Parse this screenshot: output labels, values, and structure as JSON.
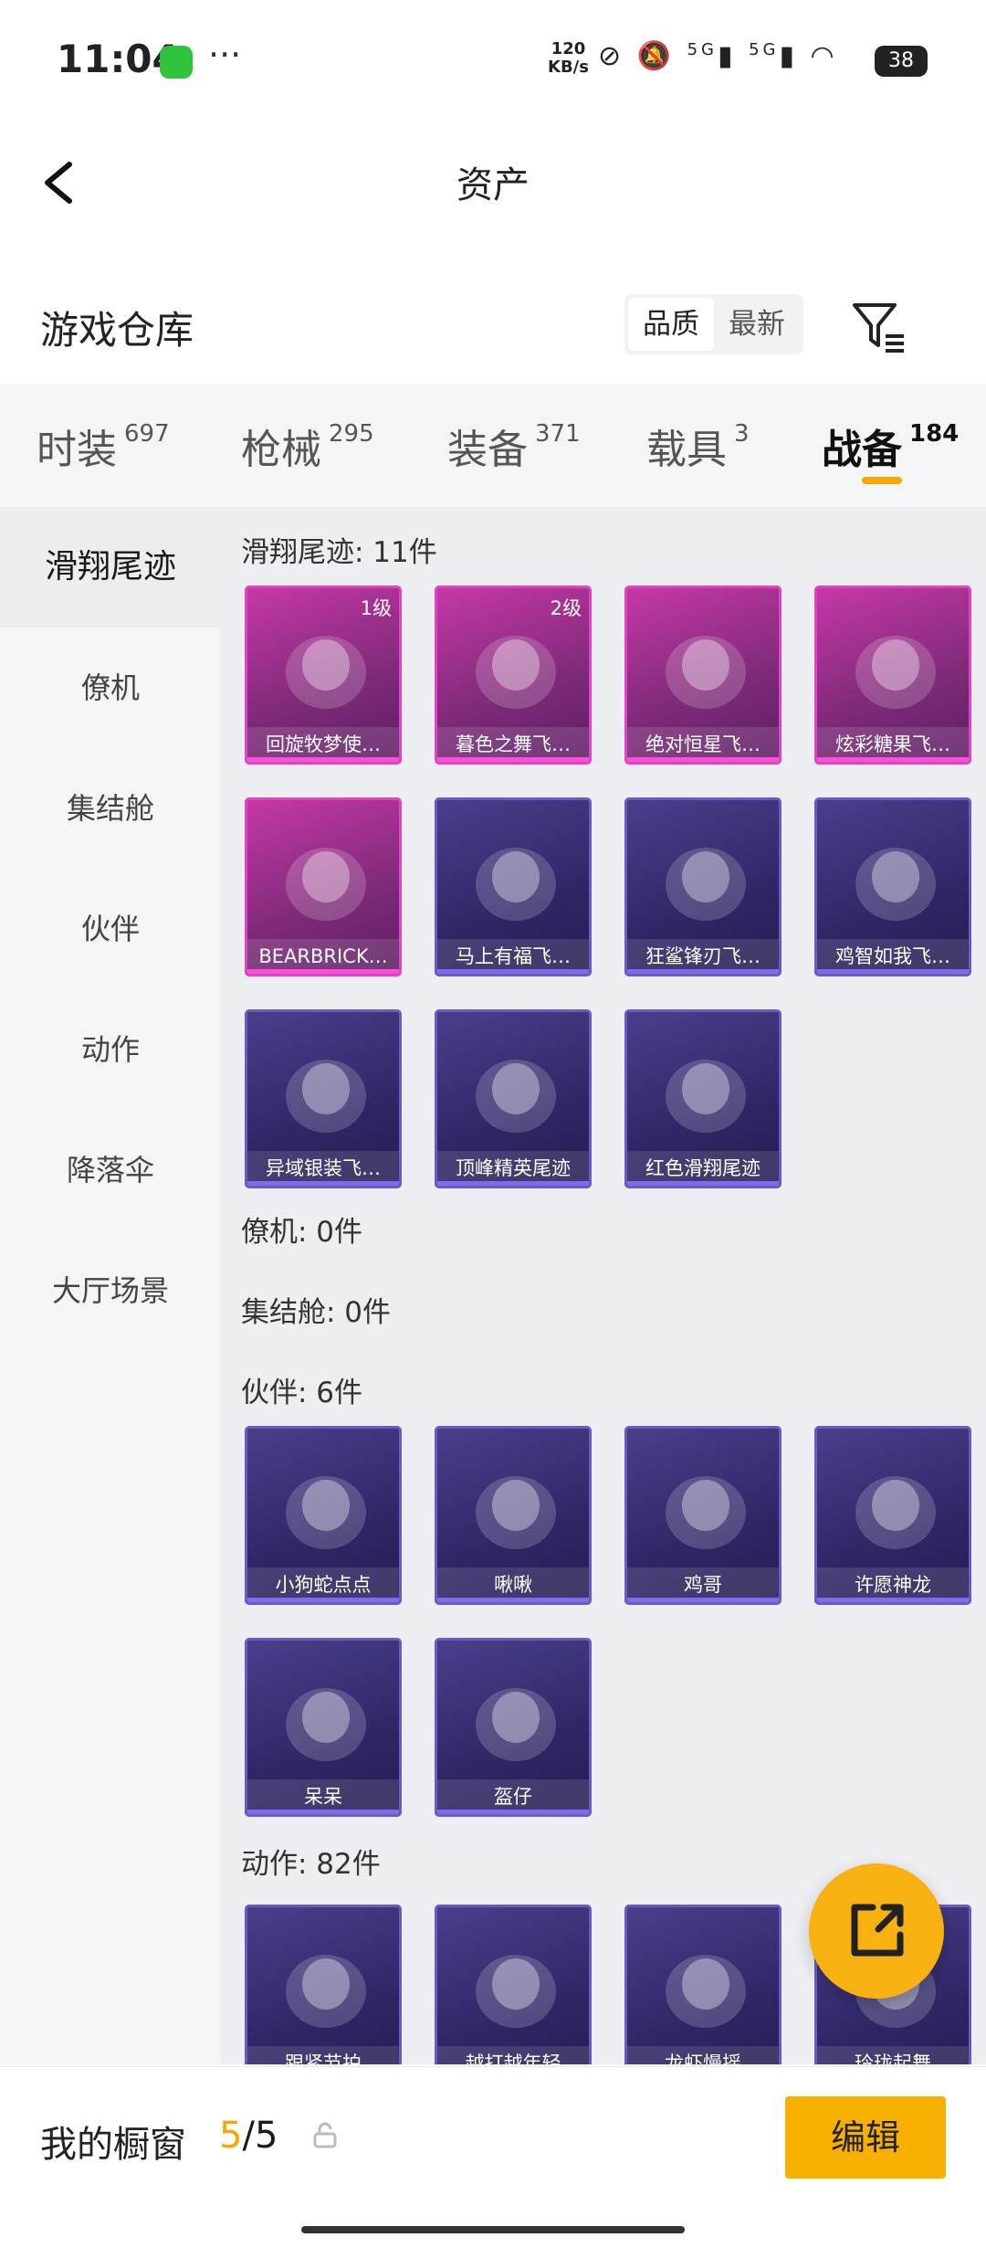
{
  "status_bar": {
    "time": "11:04",
    "dots": "···",
    "net_speed_value": "120",
    "net_speed_unit": "KB/s",
    "signal_1": "5G",
    "signal_2": "5G",
    "battery": "38"
  },
  "header": {
    "title": "资产"
  },
  "warehouse": {
    "title": "游戏仓库",
    "sort_options": [
      "品质",
      "最新"
    ],
    "active_sort": "品质"
  },
  "tabs": [
    {
      "label": "时装",
      "count": "697"
    },
    {
      "label": "枪械",
      "count": "295"
    },
    {
      "label": "装备",
      "count": "371"
    },
    {
      "label": "载具",
      "count": "3"
    },
    {
      "label": "战备",
      "count": "184"
    }
  ],
  "active_tab": "战备",
  "sidebar": {
    "items": [
      "滑翔尾迹",
      "僚机",
      "集结舱",
      "伙伴",
      "动作",
      "降落伞",
      "大厅场景"
    ],
    "active": "滑翔尾迹"
  },
  "sections": [
    {
      "title": "滑翔尾迹: 11件",
      "items": [
        {
          "label": "回旋牧梦使…",
          "level": "1级",
          "rarity": "pink"
        },
        {
          "label": "暮色之舞飞…",
          "level": "2级",
          "rarity": "pink"
        },
        {
          "label": "绝对恒星飞…",
          "level": "",
          "rarity": "pink"
        },
        {
          "label": "炫彩糖果飞…",
          "level": "",
          "rarity": "pink"
        },
        {
          "label": "BEARBRICK…",
          "level": "",
          "rarity": "pink"
        },
        {
          "label": "马上有福飞…",
          "level": "",
          "rarity": "blue"
        },
        {
          "label": "狂鲨锋刃飞…",
          "level": "",
          "rarity": "blue"
        },
        {
          "label": "鸡智如我飞…",
          "level": "",
          "rarity": "blue"
        },
        {
          "label": "异域银装飞…",
          "level": "",
          "rarity": "blue"
        },
        {
          "label": "顶峰精英尾迹",
          "level": "",
          "rarity": "blue"
        },
        {
          "label": "红色滑翔尾迹",
          "level": "",
          "rarity": "blue"
        }
      ]
    },
    {
      "title": "僚机: 0件",
      "items": []
    },
    {
      "title": "集结舱: 0件",
      "items": []
    },
    {
      "title": "伙伴: 6件",
      "items": [
        {
          "label": "小狗蛇点点",
          "level": "",
          "rarity": "blue"
        },
        {
          "label": "啾啾",
          "level": "",
          "rarity": "blue"
        },
        {
          "label": "鸡哥",
          "level": "",
          "rarity": "blue"
        },
        {
          "label": "许愿神龙",
          "level": "",
          "rarity": "blue"
        },
        {
          "label": "呆呆",
          "level": "",
          "rarity": "blue"
        },
        {
          "label": "盔仔",
          "level": "",
          "rarity": "blue"
        }
      ]
    },
    {
      "title": "动作: 82件",
      "items": [
        {
          "label": "跟紧节拍",
          "level": "",
          "rarity": "blue"
        },
        {
          "label": "越打越年轻",
          "level": "",
          "rarity": "blue"
        },
        {
          "label": "龙虾慢摇",
          "level": "",
          "rarity": "blue"
        },
        {
          "label": "玲珑起舞",
          "level": "",
          "rarity": "blue"
        }
      ]
    }
  ],
  "bottom_bar": {
    "label": "我的橱窗",
    "current": "5",
    "separator": "/",
    "total": "5",
    "edit_label": "编辑"
  },
  "colors": {
    "accent": "#f7b000",
    "rare_pink": "#e043c6",
    "rare_blue": "#6a5bc4"
  }
}
